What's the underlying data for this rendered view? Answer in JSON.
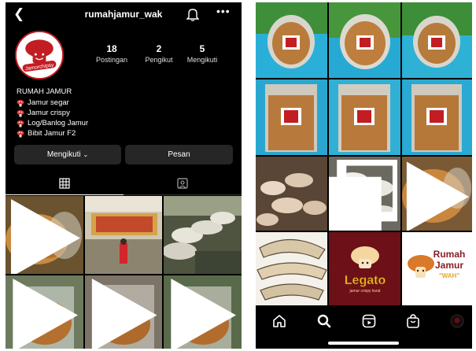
{
  "profile": {
    "username": "rumahjamur_wak",
    "avatar_text": "Jamorchipsy",
    "stats": [
      {
        "value": "18",
        "label": "Postingan"
      },
      {
        "value": "2",
        "label": "Pengikut"
      },
      {
        "value": "5",
        "label": "Mengikuti"
      }
    ],
    "bio_name": "RUMAH JAMUR",
    "bio_lines": [
      "Jamur segar",
      "Jamur crispy",
      "Log/Banlog Jamur",
      "Bibit Jamur F2"
    ],
    "follow_button": "Mengikuti",
    "message_button": "Pesan"
  },
  "explore": {
    "legato_text": "Legato",
    "legato_sub": "jamur crispy lezat",
    "rumah_text_1": "Rumah",
    "rumah_text_2": "Jamur",
    "rumah_text_3": "\"WAH\""
  },
  "colors": {
    "background": "#000000",
    "button": "#262626",
    "accent": "#c21d22",
    "legato_bg": "#6d1017"
  },
  "icons": [
    "back-arrow-icon",
    "bell-icon",
    "more-icon",
    "grid-icon",
    "tagged-icon",
    "home-icon",
    "search-icon",
    "reels-icon",
    "shop-icon",
    "profile-icon",
    "reel-icon"
  ]
}
